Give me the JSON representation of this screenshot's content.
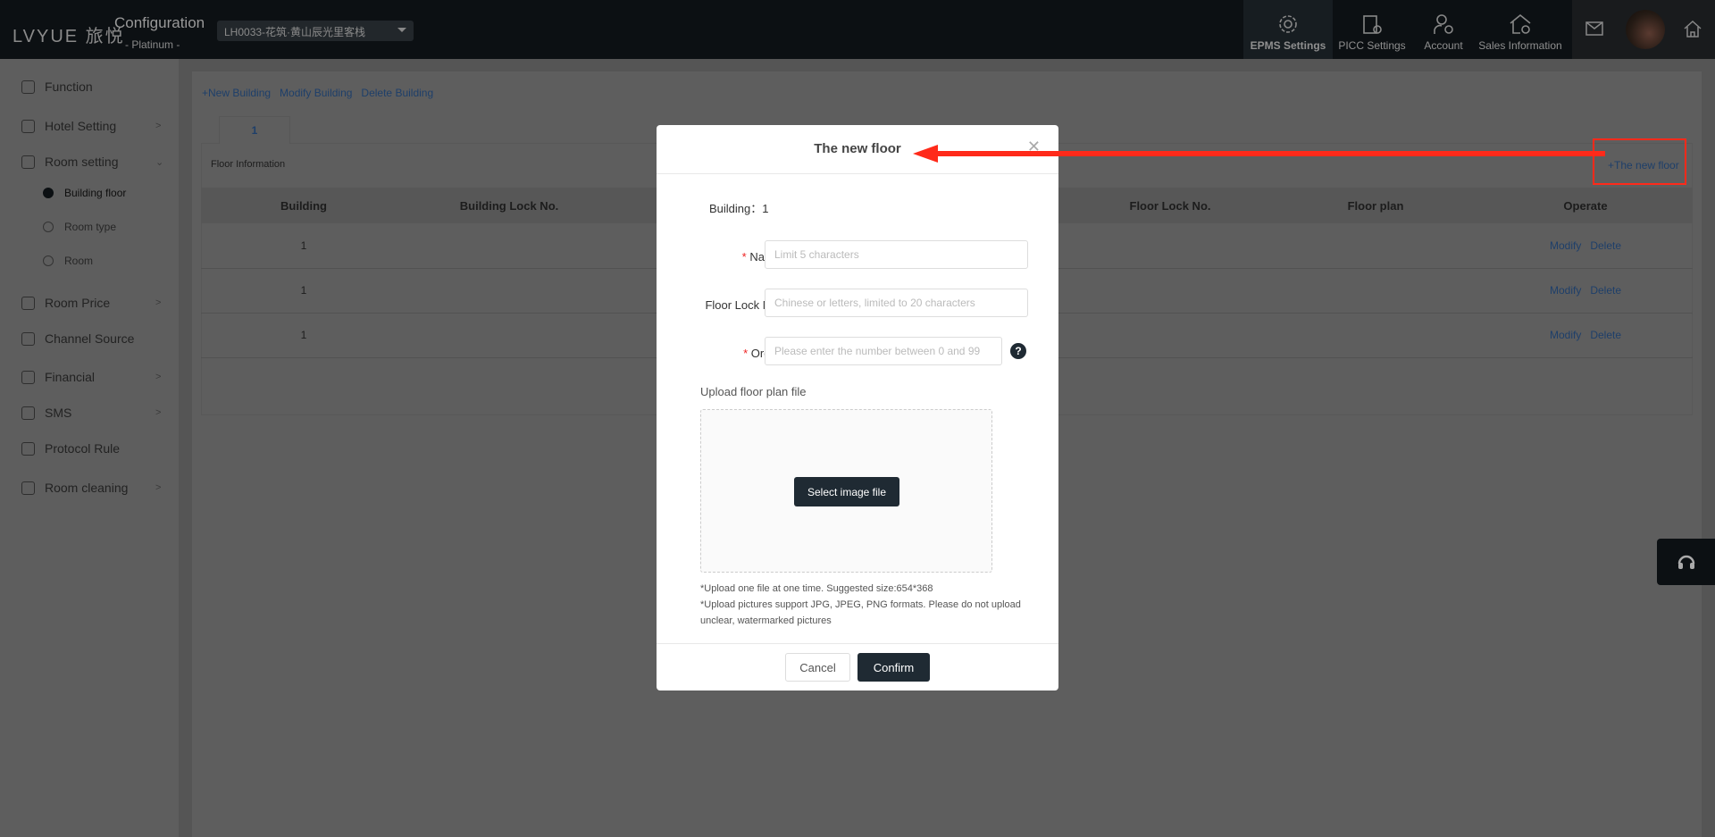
{
  "header": {
    "logo": "LVYUE 旅悦",
    "title": "Configuration",
    "edition": "- Platinum -",
    "hotel_select": "LH0033-花筑·黄山辰光里客栈",
    "nav": [
      {
        "label": "EPMS Settings",
        "icon": "gear-icon",
        "active": true
      },
      {
        "label": "PICC Settings",
        "icon": "clipboard-yuan-icon"
      },
      {
        "label": "Account",
        "icon": "user-gear-icon"
      },
      {
        "label": "Sales Information",
        "icon": "house-yuan-icon"
      }
    ]
  },
  "sidebar": {
    "items": [
      {
        "label": "Function"
      },
      {
        "label": "Hotel Setting"
      },
      {
        "label": "Room setting"
      },
      {
        "label": "Room Price"
      },
      {
        "label": "Channel Source"
      },
      {
        "label": "Financial"
      },
      {
        "label": "SMS"
      },
      {
        "label": "Protocol Rule"
      },
      {
        "label": "Room cleaning"
      }
    ],
    "sub_items": [
      {
        "label": "Building floor",
        "selected": true
      },
      {
        "label": "Room type"
      },
      {
        "label": "Room"
      }
    ]
  },
  "main": {
    "actions": [
      "+New Building",
      "Modify Building",
      "Delete Building"
    ],
    "tab": "1",
    "panel_title": "Floor Information",
    "new_floor": "+The new floor",
    "columns": [
      "Building",
      "Building Lock No.",
      "Floor Lock No.",
      "Floor plan",
      "Operate"
    ],
    "rows": [
      {
        "building": "1"
      },
      {
        "building": "1"
      },
      {
        "building": "1"
      }
    ],
    "modify": "Modify",
    "delete": "Delete"
  },
  "modal": {
    "title": "The new floor",
    "building_label": "Building：",
    "building_value": "1",
    "name_label": "Name：",
    "name_placeholder": "Limit 5 characters",
    "lock_label": "Floor Lock No.：",
    "lock_placeholder": "Chinese or letters, limited to 20 characters",
    "order_label": "Order：",
    "order_placeholder": "Please enter the number between 0 and 99",
    "upload_label": "Upload floor plan file",
    "select_btn": "Select image file",
    "note1": "*Upload one file at one time. Suggested size:654*368",
    "note2": "*Upload pictures support JPG, JPEG, PNG formats. Please do not upload unclear, watermarked pictures",
    "cancel": "Cancel",
    "confirm": "Confirm",
    "required_mark": "*"
  },
  "colors": {
    "accent": "#2d6cc0",
    "dark": "#1f2a33",
    "annotation": "#ff2a1a"
  }
}
